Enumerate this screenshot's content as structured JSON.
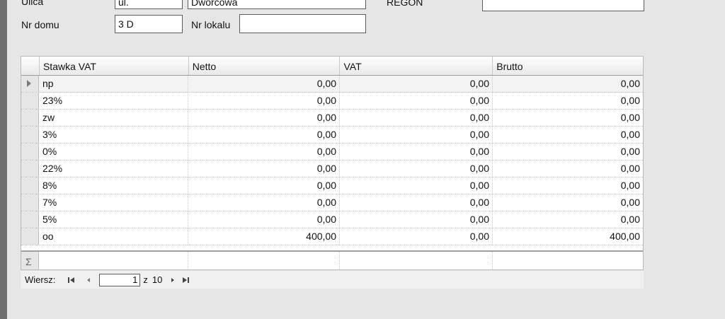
{
  "form": {
    "ulica_label": "Ulica",
    "ulica_prefix": "ul.",
    "ulica_value": "Dworcowa",
    "regon_label": "REGON",
    "regon_value": "",
    "nr_domu_label": "Nr domu",
    "nr_domu_value": "3 D",
    "nr_lokalu_label": "Nr lokalu",
    "nr_lokalu_value": ""
  },
  "grid": {
    "columns": [
      "Stawka VAT",
      "Netto",
      "VAT",
      "Brutto"
    ],
    "rows": [
      [
        "np",
        "0,00",
        "0,00",
        "0,00"
      ],
      [
        "23%",
        "0,00",
        "0,00",
        "0,00"
      ],
      [
        "zw",
        "0,00",
        "0,00",
        "0,00"
      ],
      [
        "3%",
        "0,00",
        "0,00",
        "0,00"
      ],
      [
        "0%",
        "0,00",
        "0,00",
        "0,00"
      ],
      [
        "22%",
        "0,00",
        "0,00",
        "0,00"
      ],
      [
        "8%",
        "0,00",
        "0,00",
        "0,00"
      ],
      [
        "7%",
        "0,00",
        "0,00",
        "0,00"
      ],
      [
        "5%",
        "0,00",
        "0,00",
        "0,00"
      ],
      [
        "oo",
        "400,00",
        "0,00",
        "400,00"
      ]
    ],
    "summary_symbol": "Σ"
  },
  "pager": {
    "label": "Wiersz:",
    "current": "1",
    "of_label": "z",
    "total": "10",
    "first_icon": "first-page-icon",
    "prev_icon": "prev-page-icon",
    "next_icon": "next-page-icon",
    "last_icon": "last-page-icon"
  }
}
